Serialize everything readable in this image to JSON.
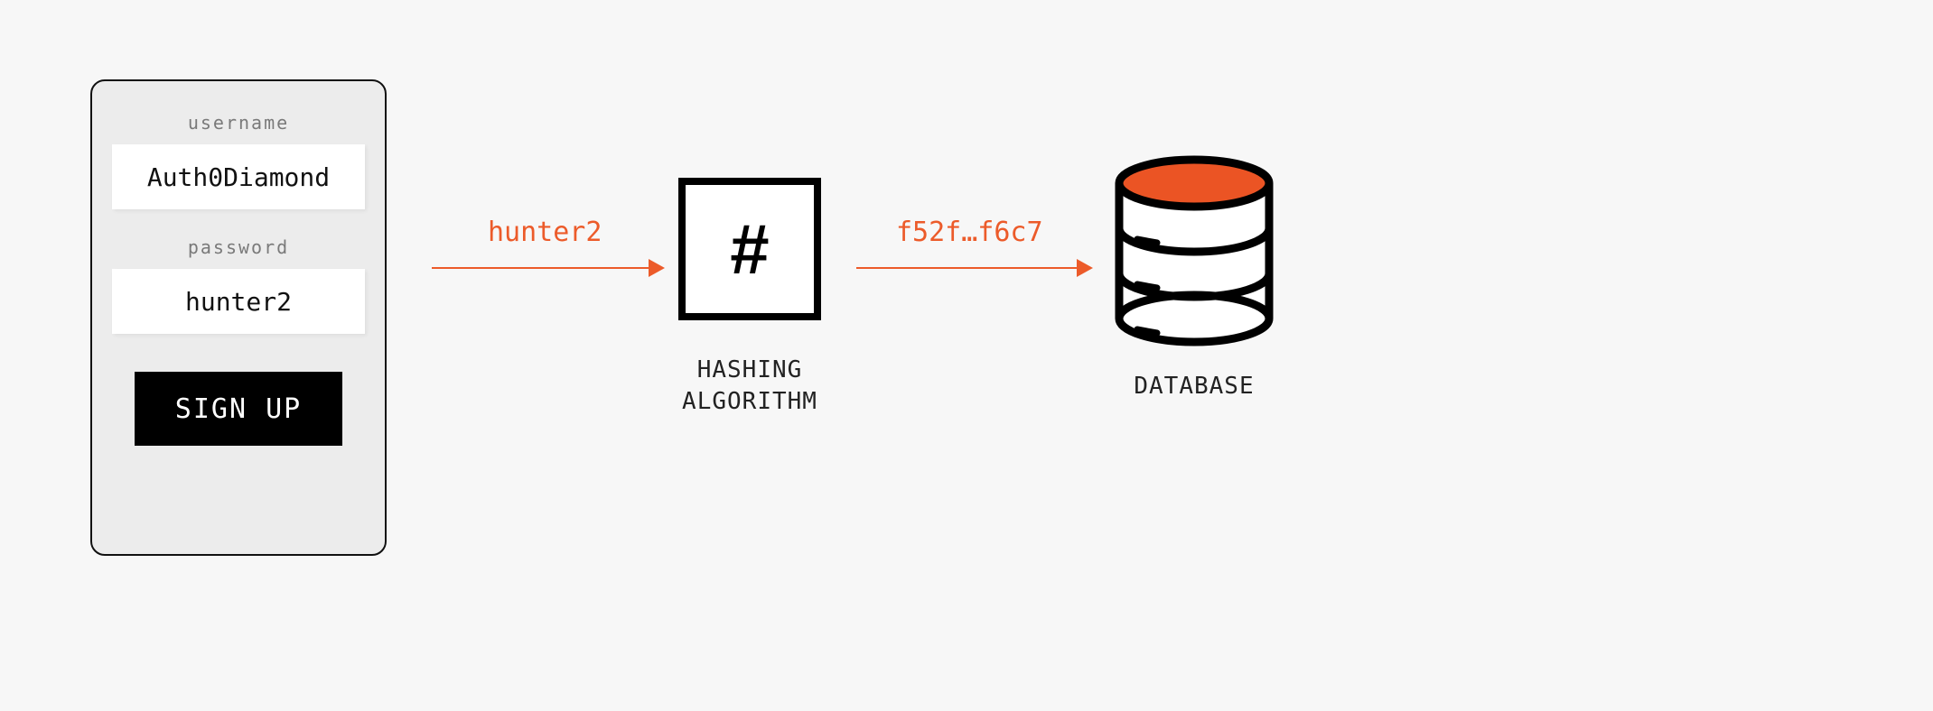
{
  "form": {
    "username_label": "username",
    "username_value": "Auth0Diamond",
    "password_label": "password",
    "password_value": "hunter2",
    "submit_label": "SIGN UP"
  },
  "flow": {
    "arrow1_label": "hunter2",
    "arrow2_label": "f52f…f6c7"
  },
  "hash": {
    "symbol": "#",
    "caption": "HASHING\nALGORITHM"
  },
  "db": {
    "caption": "DATABASE"
  },
  "colors": {
    "accent": "#ec5b2a",
    "ink": "#000000",
    "bg": "#f7f7f7",
    "card": "#ececec"
  }
}
